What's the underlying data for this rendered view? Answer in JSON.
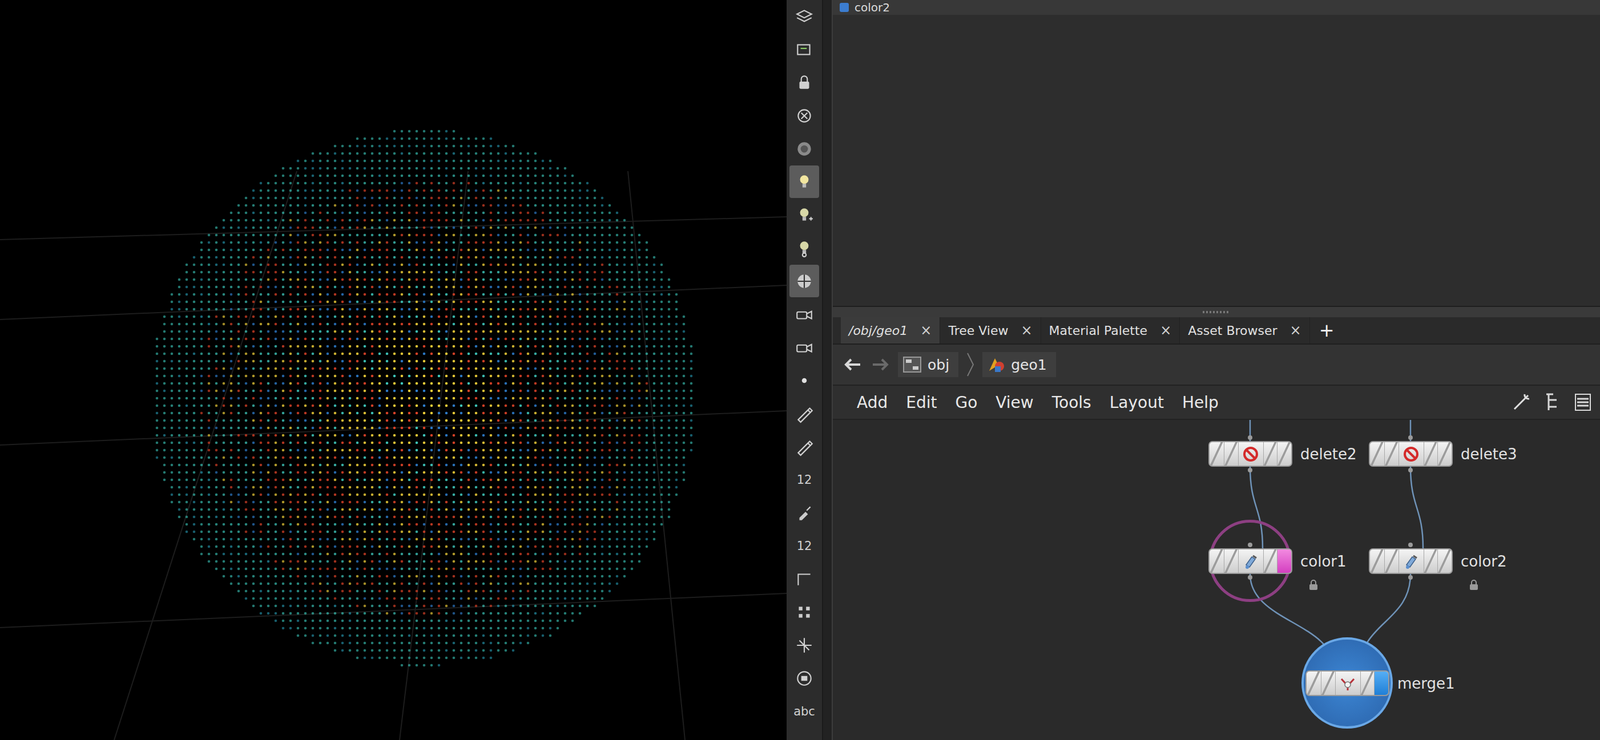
{
  "parameter_pane": {
    "title": "color2"
  },
  "shelf": [
    {
      "kind": "icon",
      "selected": false
    },
    {
      "kind": "icon",
      "selected": false
    },
    {
      "kind": "icon",
      "selected": false
    },
    {
      "kind": "icon",
      "selected": false
    },
    {
      "kind": "icon",
      "selected": false
    },
    {
      "kind": "icon",
      "selected": true
    },
    {
      "kind": "icon",
      "selected": false
    },
    {
      "kind": "icon",
      "selected": false
    },
    {
      "kind": "icon",
      "selected": true
    },
    {
      "kind": "icon",
      "selected": false
    },
    {
      "kind": "icon",
      "selected": false
    },
    {
      "kind": "icon",
      "selected": false
    },
    {
      "kind": "icon",
      "selected": false
    },
    {
      "kind": "icon",
      "selected": false
    },
    {
      "kind": "label",
      "text": "12",
      "selected": false
    },
    {
      "kind": "icon",
      "selected": false
    },
    {
      "kind": "label",
      "text": "12",
      "selected": false
    },
    {
      "kind": "icon",
      "selected": false
    },
    {
      "kind": "icon",
      "selected": false
    },
    {
      "kind": "icon",
      "selected": false
    },
    {
      "kind": "icon",
      "selected": false
    },
    {
      "kind": "label",
      "text": "abc",
      "selected": false
    }
  ],
  "network_tabs": [
    {
      "label": "/obj/geo1",
      "close": "×",
      "selected": true
    },
    {
      "label": "Tree View",
      "close": "×",
      "selected": false
    },
    {
      "label": "Material Palette",
      "close": "×",
      "selected": false
    },
    {
      "label": "Asset Browser",
      "close": "×",
      "selected": false
    }
  ],
  "add_tab": "+",
  "path": [
    {
      "label": "obj"
    },
    {
      "label": "geo1"
    }
  ],
  "menu": [
    "Add",
    "Edit",
    "Go",
    "View",
    "Tools",
    "Layout",
    "Help"
  ],
  "nodes": [
    {
      "name": "delete2",
      "kind": "delete",
      "input_above": true,
      "hovered": false,
      "template": false,
      "display": false,
      "locked": false
    },
    {
      "name": "delete3",
      "kind": "delete",
      "input_above": true,
      "hovered": false,
      "template": false,
      "display": false,
      "locked": false
    },
    {
      "name": "color1",
      "kind": "color",
      "input_above": false,
      "hovered": true,
      "template": true,
      "display": false,
      "locked": true
    },
    {
      "name": "color2",
      "kind": "color",
      "input_above": false,
      "hovered": false,
      "template": false,
      "display": false,
      "locked": true
    },
    {
      "name": "merge1",
      "kind": "merge",
      "input_above": false,
      "hovered": false,
      "template": false,
      "display": true,
      "locked": false
    }
  ],
  "wires": [
    {
      "from": "delete2",
      "to": "color1"
    },
    {
      "from": "delete3",
      "to": "color2"
    },
    {
      "from": "color1",
      "to": "merge1"
    },
    {
      "from": "color2",
      "to": "merge1"
    }
  ]
}
